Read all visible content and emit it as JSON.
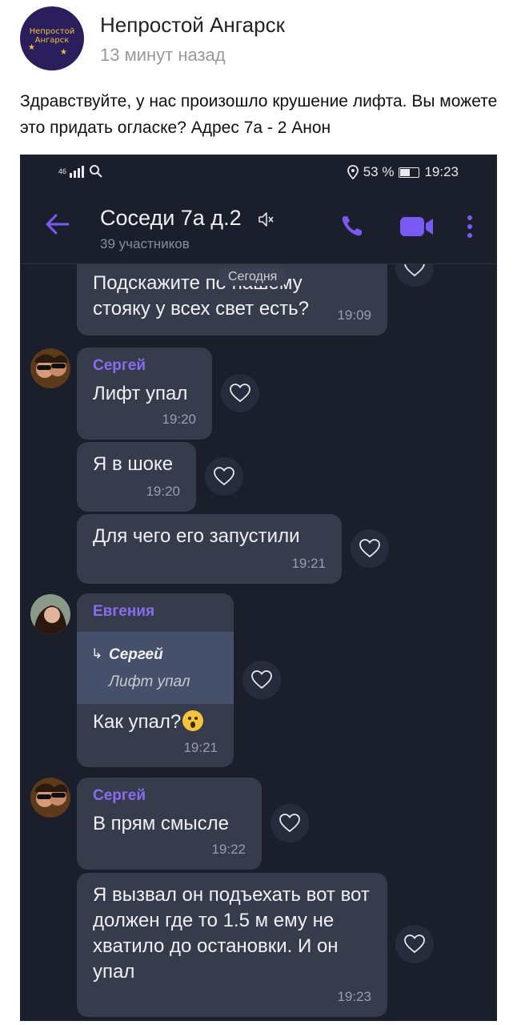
{
  "post": {
    "page_name": "Непростой Ангарск",
    "time": "13 минут назад",
    "text": "Здравствуйте, у нас произошло крушение лифта. Вы можете это придать огласке? Адрес 7а - 2 Анон",
    "avatar_logo_line1": "Непростой",
    "avatar_logo_line2": "Ангарск"
  },
  "status_bar": {
    "signal": "46",
    "battery": "53 %",
    "clock": "19:23"
  },
  "chat": {
    "title": "Соседи 7а д.2",
    "subtitle": "39 участников",
    "date_chip": "Сегодня"
  },
  "messages": [
    {
      "text": "Подскажите по нашему стояку у всех свет есть?",
      "time": "19:09"
    },
    {
      "sender": "Сергей",
      "text": "Лифт упал",
      "time": "19:20"
    },
    {
      "text": "Я в шоке",
      "time": "19:20"
    },
    {
      "text": "Для чего его запустили",
      "time": "19:21"
    },
    {
      "sender": "Евгения",
      "reply_sender": "Сергей",
      "reply_text": "Лифт упал",
      "text": "Как упал?",
      "emoji": "astonished-face",
      "time": "19:21"
    },
    {
      "sender": "Сергей",
      "text": "В прям смысле",
      "time": "19:22"
    },
    {
      "text": "Я вызвал он подъехать вот вот должен где то 1.5 м ему не хватило до остановки. И он упал",
      "time": "19:23"
    }
  ],
  "colors": {
    "chat_bg": "#1b1f2c",
    "bubble": "#363c4b",
    "accent": "#7a5af5",
    "sender_name": "#8a6cf0"
  }
}
